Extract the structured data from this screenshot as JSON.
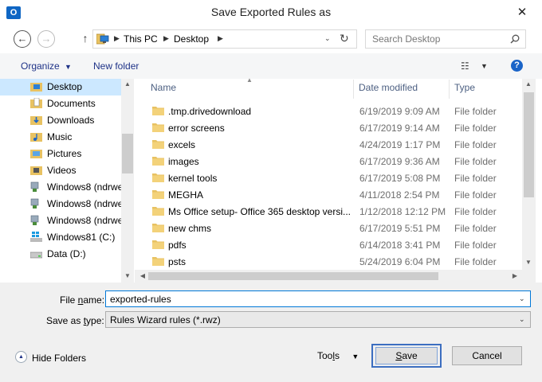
{
  "window": {
    "title": "Save Exported Rules as",
    "app_badge": "O",
    "close_glyph": "✕"
  },
  "address": {
    "crumbs": [
      "This PC",
      "Desktop"
    ],
    "search_placeholder": "Search Desktop"
  },
  "toolbar": {
    "organize_label": "Organize",
    "new_folder_label": "New folder"
  },
  "nav_items": [
    {
      "label": "Desktop",
      "icon": "desktop-folder-icon"
    },
    {
      "label": "Documents",
      "icon": "documents-folder-icon"
    },
    {
      "label": "Downloads",
      "icon": "downloads-folder-icon"
    },
    {
      "label": "Music",
      "icon": "music-folder-icon"
    },
    {
      "label": "Pictures",
      "icon": "pictures-folder-icon"
    },
    {
      "label": "Videos",
      "icon": "videos-folder-icon"
    },
    {
      "label": "Windows8 (ndrwe",
      "icon": "network-drive-icon"
    },
    {
      "label": "Windows8 (ndrwe",
      "icon": "network-drive-icon"
    },
    {
      "label": "Windows8 (ndrwe",
      "icon": "network-drive-icon"
    },
    {
      "label": "Windows81 (C:)",
      "icon": "windows-drive-icon"
    },
    {
      "label": "Data (D:)",
      "icon": "disk-drive-icon"
    }
  ],
  "columns": {
    "name": "Name",
    "date": "Date modified",
    "type": "Type"
  },
  "files": [
    {
      "name": ".tmp.drivedownload",
      "date": "6/19/2019 9:09 AM",
      "type": "File folder"
    },
    {
      "name": "error screens",
      "date": "6/17/2019 9:14 AM",
      "type": "File folder"
    },
    {
      "name": "excels",
      "date": "4/24/2019 1:17 PM",
      "type": "File folder"
    },
    {
      "name": "images",
      "date": "6/17/2019 9:36 AM",
      "type": "File folder"
    },
    {
      "name": "kernel tools",
      "date": "6/17/2019 5:08 PM",
      "type": "File folder"
    },
    {
      "name": "MEGHA",
      "date": "4/11/2018 2:54 PM",
      "type": "File folder"
    },
    {
      "name": "Ms Office setup- Office 365 desktop versi...",
      "date": "1/12/2018 12:12 PM",
      "type": "File folder"
    },
    {
      "name": "new chms",
      "date": "6/17/2019 5:51 PM",
      "type": "File folder"
    },
    {
      "name": "pdfs",
      "date": "6/14/2018 3:41 PM",
      "type": "File folder"
    },
    {
      "name": "psts",
      "date": "5/24/2019 6:04 PM",
      "type": "File folder"
    }
  ],
  "form": {
    "file_name_label_pre": "File ",
    "file_name_label_key": "n",
    "file_name_label_post": "ame:",
    "file_name_value": "exported-rules",
    "save_type_label_pre": "Save as ",
    "save_type_label_key": "t",
    "save_type_label_post": "ype:",
    "save_type_value": "Rules Wizard rules (*.rwz)"
  },
  "footer": {
    "hide_folders_label": "Hide Folders",
    "tools_label_pre": "Too",
    "tools_label_key": "l",
    "tools_label_post": "s",
    "save_label_key": "S",
    "save_label_post": "ave",
    "cancel_label": "Cancel"
  }
}
